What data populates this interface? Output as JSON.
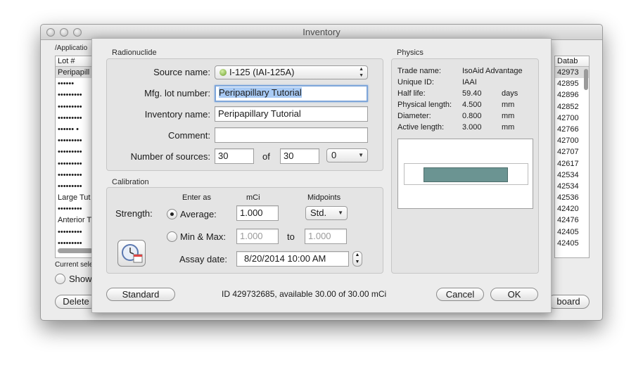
{
  "window": {
    "title": "Inventory",
    "path": "/Applicatio",
    "lot_header": "Lot #",
    "lot_rows": [
      "Peripapill",
      "•••••• ",
      "•••••••••",
      "•••••••••",
      "•••••••••",
      "•••••• •",
      "•••••••••",
      "•••••••••",
      "•••••••••",
      "•••••••••",
      "•••••••••",
      "Large Tut",
      "•••••••••",
      "Anterior T",
      "•••••••••",
      "•••••••••"
    ],
    "db_header": "Datab",
    "db_rows": [
      "42973",
      "42895",
      "42896",
      "42852",
      "42700",
      "42766",
      "42700",
      "42707",
      "42617",
      "42534",
      "42534",
      "42536",
      "42420",
      "42476",
      "42405",
      "42405"
    ],
    "current_sel": "Current sele",
    "show_all": "Show",
    "delete_btn": "Delete",
    "board_btn": "board"
  },
  "dialog": {
    "radionuclide_title": "Radionuclide",
    "source_label": "Source name:",
    "source_value": "I-125 (IAI-125A)",
    "mfg_label": "Mfg. lot number:",
    "mfg_value": "Peripapillary Tutorial",
    "inv_label": "Inventory name:",
    "inv_value": "Peripapillary Tutorial",
    "comment_label": "Comment:",
    "comment_value": "",
    "num_label": "Number of sources:",
    "num_value": "30",
    "of_label": "of",
    "of_value": "30",
    "extra_select": "0",
    "calibration_title": "Calibration",
    "enter_as": "Enter as",
    "unit": "mCi",
    "midpoints": "Midpoints",
    "strength_label": "Strength:",
    "average_label": "Average:",
    "average_value": "1.000",
    "std_select": "Std.",
    "minmax_label": "Min & Max:",
    "min_value": "1.000",
    "to_label": "to",
    "max_value": "1.000",
    "assay_label": "Assay date:",
    "assay_value": "8/20/2014 10:00 AM",
    "physics_title": "Physics",
    "physics": [
      {
        "label": "Trade name:",
        "value": "IsoAid Advantage",
        "unit": ""
      },
      {
        "label": "Unique ID:",
        "value": "IAAI",
        "unit": ""
      },
      {
        "label": "Half life:",
        "value": "59.40",
        "unit": "days"
      },
      {
        "label": "Physical length:",
        "value": "4.500",
        "unit": "mm"
      },
      {
        "label": "Diameter:",
        "value": "0.800",
        "unit": "mm"
      },
      {
        "label": "Active length:",
        "value": "3.000",
        "unit": "mm"
      }
    ],
    "standard_btn": "Standard",
    "status": "ID 429732685, available 30.00 of 30.00 mCi",
    "cancel_btn": "Cancel",
    "ok_btn": "OK"
  }
}
